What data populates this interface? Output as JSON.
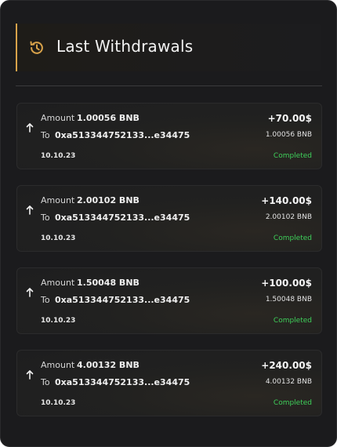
{
  "header": {
    "title": "Last Withdrawals",
    "icon": "history-icon",
    "accent": "#d8a24a"
  },
  "labels": {
    "amount": "Amount",
    "to": "To"
  },
  "status_color": "#3ecf5a",
  "withdrawals": [
    {
      "amount": "1.00056 BNB",
      "address": "0xa513344752133...e34475",
      "date": "10.10.23",
      "usd": "+70.00$",
      "bnb": "1.00056 BNB",
      "status": "Completed"
    },
    {
      "amount": "2.00102 BNB",
      "address": "0xa513344752133...e34475",
      "date": "10.10.23",
      "usd": "+140.00$",
      "bnb": "2.00102 BNB",
      "status": "Completed"
    },
    {
      "amount": "1.50048 BNB",
      "address": "0xa513344752133...e34475",
      "date": "10.10.23",
      "usd": "+100.00$",
      "bnb": "1.50048 BNB",
      "status": "Completed"
    },
    {
      "amount": "4.00132 BNB",
      "address": "0xa513344752133...e34475",
      "date": "10.10.23",
      "usd": "+240.00$",
      "bnb": "4.00132 BNB",
      "status": "Completed"
    }
  ]
}
